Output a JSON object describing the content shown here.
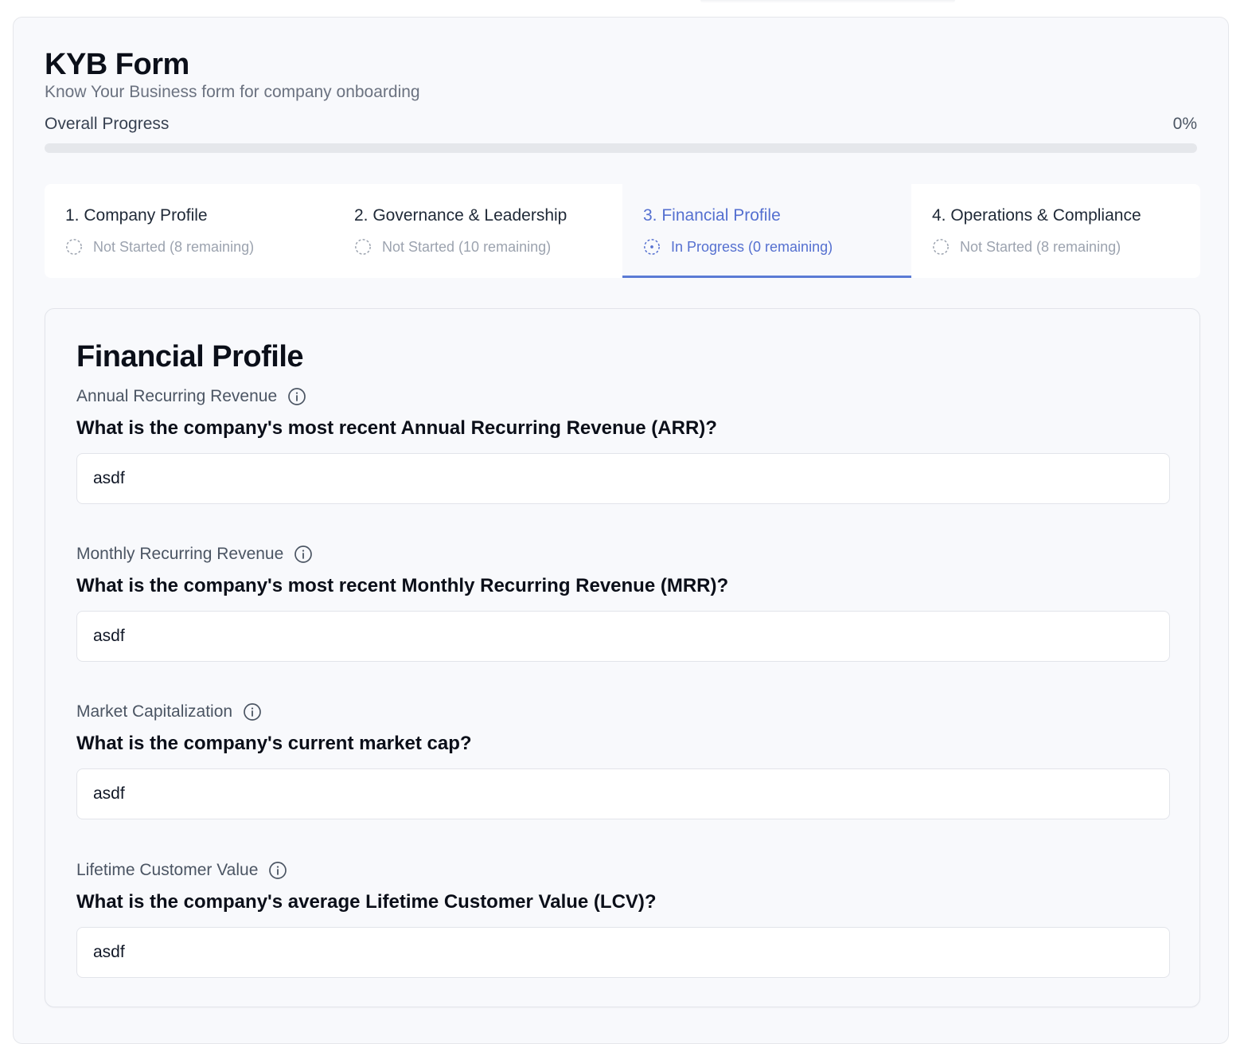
{
  "form": {
    "title": "KYB Form",
    "subtitle": "Know Your Business form for company onboarding"
  },
  "progress": {
    "label": "Overall Progress",
    "percent_text": "0%",
    "value": 0
  },
  "tabs": [
    {
      "title": "1. Company Profile",
      "status": "Not Started (8 remaining)",
      "active": false
    },
    {
      "title": "2. Governance & Leadership",
      "status": "Not Started (10 remaining)",
      "active": false
    },
    {
      "title": "3. Financial Profile",
      "status": "In Progress (0 remaining)",
      "active": true
    },
    {
      "title": "4. Operations & Compliance",
      "status": "Not Started (8 remaining)",
      "active": false
    }
  ],
  "section": {
    "title": "Financial Profile",
    "fields": [
      {
        "label": "Annual Recurring Revenue",
        "question": "What is the company's most recent Annual Recurring Revenue (ARR)?",
        "value": "asdf"
      },
      {
        "label": "Monthly Recurring Revenue",
        "question": "What is the company's most recent Monthly Recurring Revenue (MRR)?",
        "value": "asdf"
      },
      {
        "label": "Market Capitalization",
        "question": "What is the company's current market cap?",
        "value": "asdf"
      },
      {
        "label": "Lifetime Customer Value",
        "question": "What is the company's average Lifetime Customer Value (LCV)?",
        "value": "asdf"
      }
    ]
  },
  "colors": {
    "accent": "#5b7bd5",
    "inactive_status": "#9ca3af",
    "card_bg": "#f8f9fc"
  }
}
